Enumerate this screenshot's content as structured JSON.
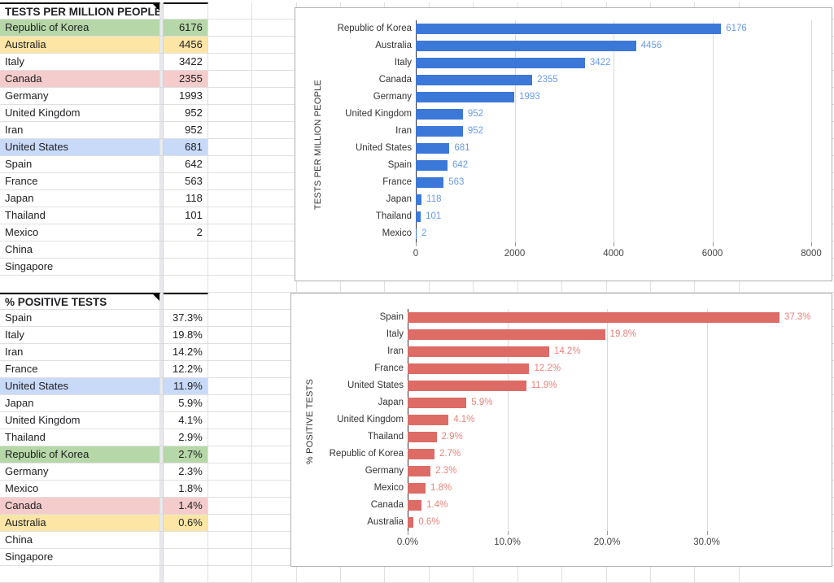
{
  "sheet": {
    "table1": {
      "header_label": "TESTS PER MILLION PEOPLE",
      "header_value": "",
      "rows": [
        {
          "name": "Republic of Korea",
          "value": "6176",
          "fill": "green"
        },
        {
          "name": "Australia",
          "value": "4456",
          "fill": "yellow"
        },
        {
          "name": "Italy",
          "value": "3422",
          "fill": "none"
        },
        {
          "name": "Canada",
          "value": "2355",
          "fill": "red"
        },
        {
          "name": "Germany",
          "value": "1993",
          "fill": "none"
        },
        {
          "name": "United Kingdom",
          "value": "952",
          "fill": "none"
        },
        {
          "name": "Iran",
          "value": "952",
          "fill": "none"
        },
        {
          "name": "United States",
          "value": "681",
          "fill": "blue"
        },
        {
          "name": "Spain",
          "value": "642",
          "fill": "none"
        },
        {
          "name": "France",
          "value": "563",
          "fill": "none"
        },
        {
          "name": "Japan",
          "value": "118",
          "fill": "none"
        },
        {
          "name": "Thailand",
          "value": "101",
          "fill": "none"
        },
        {
          "name": "Mexico",
          "value": "2",
          "fill": "none"
        },
        {
          "name": "China",
          "value": "",
          "fill": "none"
        },
        {
          "name": "Singapore",
          "value": "",
          "fill": "none"
        },
        {
          "name": "",
          "value": "",
          "fill": "none"
        }
      ]
    },
    "table2": {
      "header_label": "% POSITIVE TESTS",
      "header_value": "",
      "rows": [
        {
          "name": "Spain",
          "value": "37.3%",
          "fill": "none"
        },
        {
          "name": "Italy",
          "value": "19.8%",
          "fill": "none"
        },
        {
          "name": "Iran",
          "value": "14.2%",
          "fill": "none"
        },
        {
          "name": "France",
          "value": "12.2%",
          "fill": "none"
        },
        {
          "name": "United States",
          "value": "11.9%",
          "fill": "blue"
        },
        {
          "name": "Japan",
          "value": "5.9%",
          "fill": "none"
        },
        {
          "name": "United Kingdom",
          "value": "4.1%",
          "fill": "none"
        },
        {
          "name": "Thailand",
          "value": "2.9%",
          "fill": "none"
        },
        {
          "name": "Republic of Korea",
          "value": "2.7%",
          "fill": "green"
        },
        {
          "name": "Germany",
          "value": "2.3%",
          "fill": "none"
        },
        {
          "name": "Mexico",
          "value": "1.8%",
          "fill": "none"
        },
        {
          "name": "Canada",
          "value": "1.4%",
          "fill": "red"
        },
        {
          "name": "Australia",
          "value": "0.6%",
          "fill": "yellow"
        },
        {
          "name": "China",
          "value": "",
          "fill": "none"
        },
        {
          "name": "Singapore",
          "value": "",
          "fill": "none"
        }
      ]
    },
    "colors": {
      "fill_green": "#b6d7a8",
      "fill_yellow": "#fce5a5",
      "fill_red": "#f4cccc",
      "fill_blue": "#c9daf8",
      "grid_line": "#e0e0e0"
    }
  },
  "chart_data": [
    {
      "type": "bar",
      "orientation": "horizontal",
      "title": "",
      "ylabel": "TESTS PER MILLION PEOPLE",
      "xlabel": "",
      "categories": [
        "Republic of Korea",
        "Australia",
        "Italy",
        "Canada",
        "Germany",
        "United Kingdom",
        "Iran",
        "United States",
        "Spain",
        "France",
        "Japan",
        "Thailand",
        "Mexico"
      ],
      "values": [
        6176,
        4456,
        3422,
        2355,
        1993,
        952,
        952,
        681,
        642,
        563,
        118,
        101,
        2
      ],
      "data_labels": [
        "6176",
        "4456",
        "3422",
        "2355",
        "1993",
        "952",
        "952",
        "681",
        "642",
        "563",
        "118",
        "101",
        "2"
      ],
      "xticks": [
        0,
        2000,
        4000,
        6000,
        8000
      ],
      "xtick_labels": [
        "0",
        "2000",
        "4000",
        "6000",
        "8000"
      ],
      "xlim": [
        0,
        8000
      ],
      "bar_color": "#3c78d8",
      "label_color": "#6a9bea",
      "grid": true,
      "legend": "none"
    },
    {
      "type": "bar",
      "orientation": "horizontal",
      "title": "",
      "ylabel": "% POSITIVE TESTS",
      "xlabel": "",
      "categories": [
        "Spain",
        "Italy",
        "Iran",
        "France",
        "United States",
        "Japan",
        "United Kingdom",
        "Thailand",
        "Republic of Korea",
        "Germany",
        "Mexico",
        "Canada",
        "Australia"
      ],
      "values": [
        37.3,
        19.8,
        14.2,
        12.2,
        11.9,
        5.9,
        4.1,
        2.9,
        2.7,
        2.3,
        1.8,
        1.4,
        0.6
      ],
      "data_labels": [
        "37.3%",
        "19.8%",
        "14.2%",
        "12.2%",
        "11.9%",
        "5.9%",
        "4.1%",
        "2.9%",
        "2.7%",
        "2.3%",
        "1.8%",
        "1.4%",
        "0.6%"
      ],
      "xticks": [
        0,
        10,
        20,
        30
      ],
      "xtick_labels": [
        "0.0%",
        "10.0%",
        "20.0%",
        "30.0%"
      ],
      "xlim": [
        0,
        40
      ],
      "bar_color": "#dd6b66",
      "label_color": "#e8837d",
      "grid": true,
      "legend": "none"
    }
  ]
}
